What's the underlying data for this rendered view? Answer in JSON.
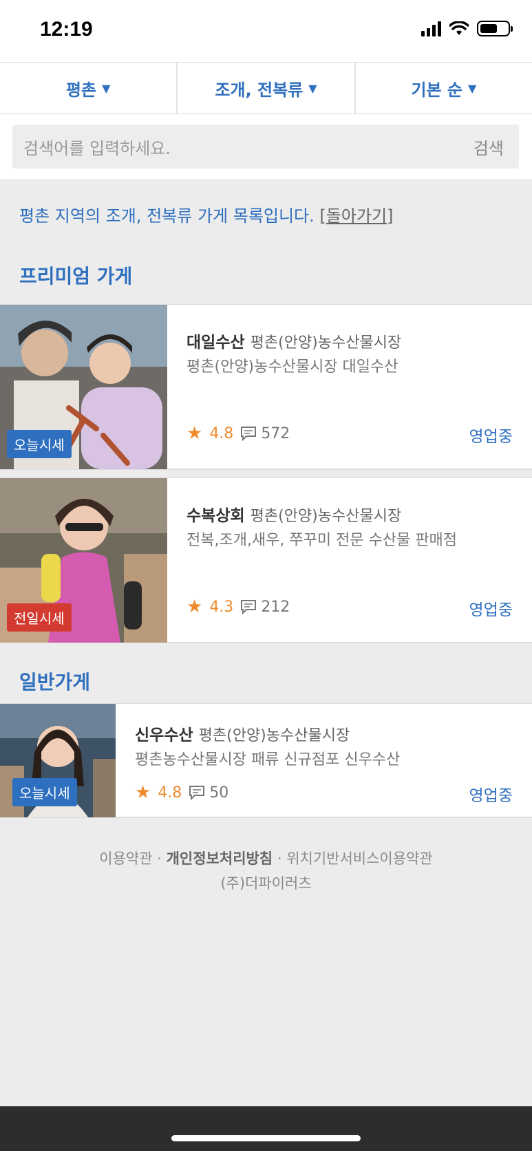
{
  "status": {
    "time": "12:19"
  },
  "filters": [
    {
      "label": "평촌"
    },
    {
      "label": "조개, 전복류"
    },
    {
      "label": "기본 순"
    }
  ],
  "search": {
    "placeholder": "검색어를 입력하세요.",
    "button": "검색"
  },
  "notice": {
    "text": "평촌 지역의 조개, 전복류 가게 목록입니다. ",
    "back": "[돌아가기]"
  },
  "premium": {
    "title": "프리미엄 가게",
    "stores": [
      {
        "name": "대일수산",
        "market": "평촌(안양)농수산물시장",
        "description": "평촌(안양)농수산물시장 대일수산",
        "badge": "오늘시세",
        "rating": "4.8",
        "reviews": "572",
        "status": "영업중"
      },
      {
        "name": "수복상회",
        "market": "평촌(안양)농수산물시장",
        "description": "전복,조개,새우, 쭈꾸미 전문 수산물 판매점",
        "badge": "전일시세",
        "rating": "4.3",
        "reviews": "212",
        "status": "영업중"
      }
    ]
  },
  "general": {
    "title": "일반가게",
    "stores": [
      {
        "name": "신우수산",
        "market": "평촌(안양)농수산물시장",
        "description": "평촌농수산물시장 패류 신규점포 신우수산",
        "badge": "오늘시세",
        "rating": "4.8",
        "reviews": "50",
        "status": "영업중"
      }
    ]
  },
  "footer": {
    "terms": "이용약관",
    "privacy": "개인정보처리방침",
    "location_terms": "위치기반서비스이용약관",
    "separator": " · ",
    "company": "(주)더파이러츠"
  },
  "colors": {
    "accent": "#2e6fbf",
    "rating": "#ee8b2c",
    "badge_today": "#2e6fbf",
    "badge_yesterday": "#d33b31"
  }
}
